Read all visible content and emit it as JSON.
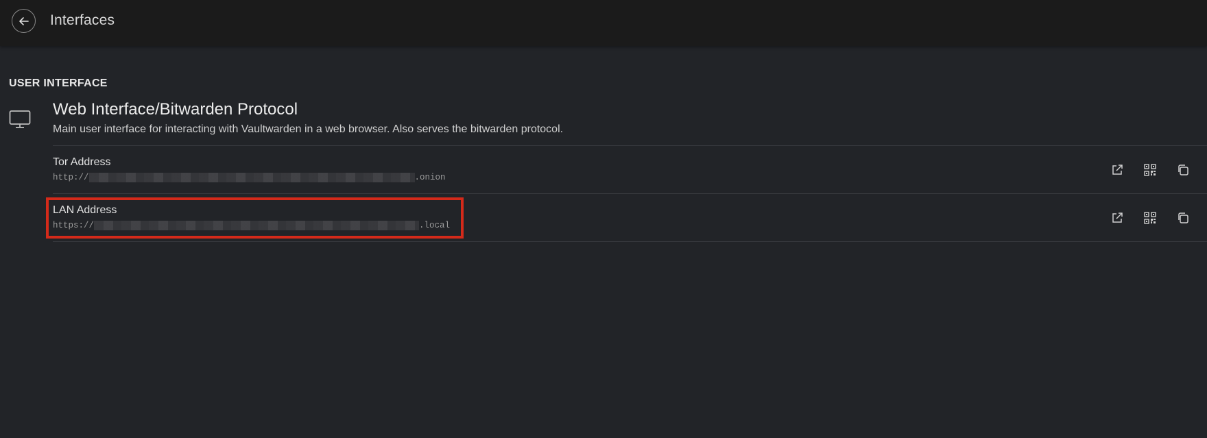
{
  "header": {
    "title": "Interfaces"
  },
  "section": {
    "title": "USER INTERFACE"
  },
  "interface": {
    "icon": "monitor-icon",
    "name": "Web Interface/Bitwarden Protocol",
    "description": "Main user interface for interacting with Vaultwarden in a web browser. Also serves the bitwarden protocol."
  },
  "addresses": [
    {
      "label": "Tor Address",
      "prefix": "http://",
      "suffix": ".onion",
      "actions": [
        "open-external-icon",
        "qr-code-icon",
        "copy-icon"
      ]
    },
    {
      "label": "LAN Address",
      "prefix": "https://",
      "suffix": ".local",
      "actions": [
        "open-external-icon",
        "qr-code-icon",
        "copy-icon"
      ]
    }
  ],
  "colors": {
    "background": "#222428",
    "topbar": "#1b1b1b",
    "highlight": "#d42a1a"
  }
}
